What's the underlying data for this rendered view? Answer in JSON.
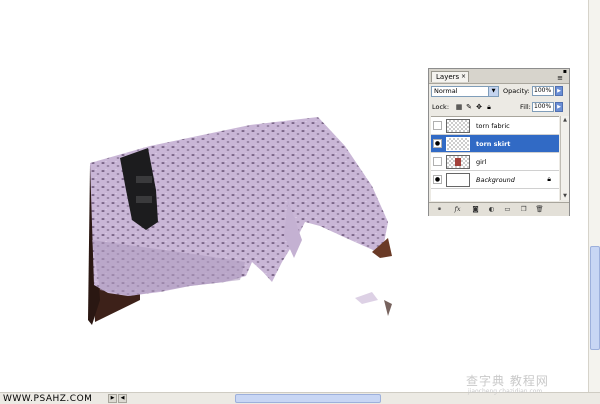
{
  "layers_panel": {
    "tab_label": "Layers",
    "tab_close": "×",
    "blend_mode": "Normal",
    "opacity_label": "Opacity:",
    "opacity_value": "100%",
    "lock_label": "Lock:",
    "fill_label": "Fill:",
    "fill_value": "100%",
    "layers": [
      {
        "name": "torn fabric",
        "visible": false,
        "selected": false
      },
      {
        "name": "torn skirt",
        "visible": true,
        "selected": true
      },
      {
        "name": "girl",
        "visible": false,
        "selected": false
      },
      {
        "name": "Background",
        "visible": true,
        "selected": false,
        "locked": true
      }
    ]
  },
  "status_bar": {
    "text": "WWW.PSAHZ.COM"
  },
  "watermark": {
    "line1": "查字典 教程网",
    "line2": "jiaocheng.chazidian.com"
  },
  "colors": {
    "selection": "#316ac5",
    "fabric": "#cdb9d8",
    "panel_bg": "#eceae4"
  }
}
